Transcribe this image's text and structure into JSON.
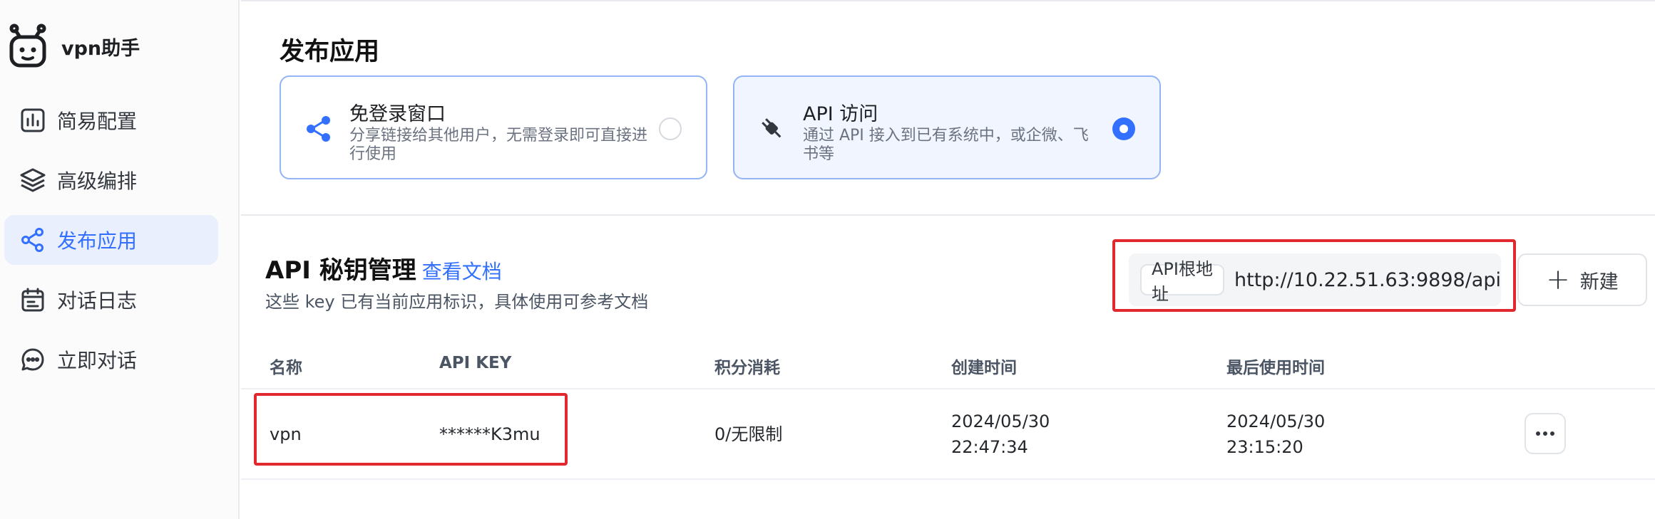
{
  "sidebar": {
    "app_name": "vpn助手",
    "items": [
      {
        "label": "简易配置",
        "icon": "bar-chart-icon",
        "active": false
      },
      {
        "label": "高级编排",
        "icon": "layers-icon",
        "active": false
      },
      {
        "label": "发布应用",
        "icon": "share-icon",
        "active": true
      },
      {
        "label": "对话日志",
        "icon": "calendar-log-icon",
        "active": false
      },
      {
        "label": "立即对话",
        "icon": "chat-bubble-icon",
        "active": false
      }
    ]
  },
  "publish": {
    "title": "发布应用",
    "cards": [
      {
        "title": "免登录窗口",
        "desc": "分享链接给其他用户，无需登录即可直接进行使用",
        "icon": "share-nodes-icon",
        "selected": false
      },
      {
        "title": "API 访问",
        "desc": "通过 API 接入到已有系统中，或企微、飞书等",
        "icon": "plug-icon",
        "selected": true
      }
    ]
  },
  "api_keys": {
    "title": "API 秘钥管理",
    "doc_link": "查看文档",
    "subtitle": "这些 key 已有当前应用标识，具体使用可参考文档",
    "base_url_label": "API根地址",
    "base_url": "http://10.22.51.63:9898/api",
    "new_button": "新建",
    "columns": [
      "名称",
      "API KEY",
      "积分消耗",
      "创建时间",
      "最后使用时间"
    ],
    "rows": [
      {
        "name": "vpn",
        "key": "******K3mu",
        "usage": "0/无限制",
        "created_date": "2024/05/30",
        "created_time": "22:47:34",
        "last_used_date": "2024/05/30",
        "last_used_time": "23:15:20"
      }
    ]
  },
  "colors": {
    "accent": "#3370ff",
    "highlight_border": "#e0282e",
    "card_border": "#94b4f6"
  }
}
